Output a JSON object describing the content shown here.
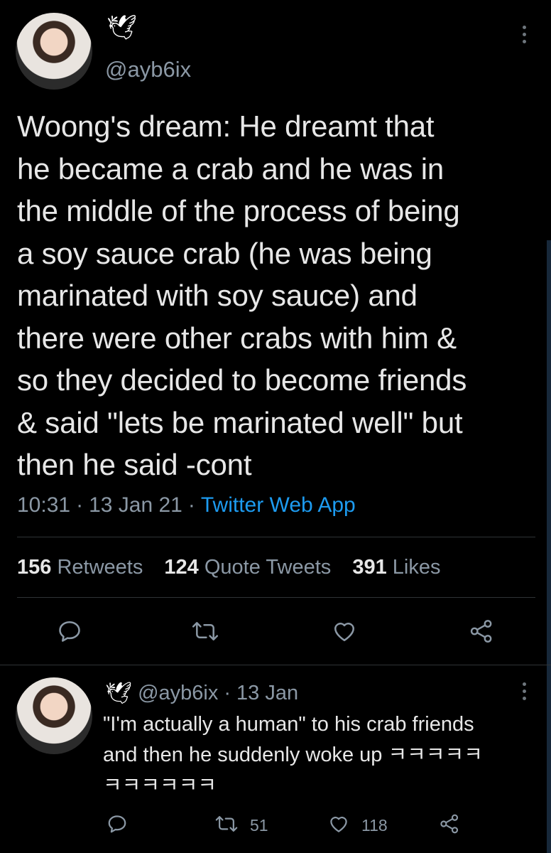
{
  "main_tweet": {
    "author_emoji": "🕊",
    "handle": "@ayb6ix",
    "text": "Woong's dream: He dreamt that\nhe became a crab and he was in\nthe middle of the process of being\na soy sauce crab (he was being\nmarinated with soy sauce) and\nthere were other crabs with him &\nso they decided to become friends\n& said \"lets be marinated well\" but\nthen he said -cont",
    "time": "10:31",
    "date": "13 Jan 21",
    "source": "Twitter Web App",
    "stats": {
      "retweets_count": "156",
      "retweets_label": "Retweets",
      "quotes_count": "124",
      "quotes_label": "Quote Tweets",
      "likes_count": "391",
      "likes_label": "Likes"
    },
    "icons": [
      "reply-icon",
      "retweet-icon",
      "like-icon",
      "share-icon",
      "more-icon"
    ]
  },
  "reply_tweet": {
    "author_emoji": "🕊",
    "handle": "@ayb6ix",
    "date": "13 Jan",
    "text": "\"I'm actually a human\" to his crab friends\nand then he suddenly woke up ㅋㅋㅋㅋㅋ\nㅋㅋㅋㅋㅋㅋ",
    "retweet_count": "51",
    "like_count": "118"
  },
  "colors": {
    "background": "#000000",
    "text": "#e7e7e7",
    "secondary": "#8b98a5",
    "link": "#1d9bf0",
    "divider": "#2f3336"
  }
}
